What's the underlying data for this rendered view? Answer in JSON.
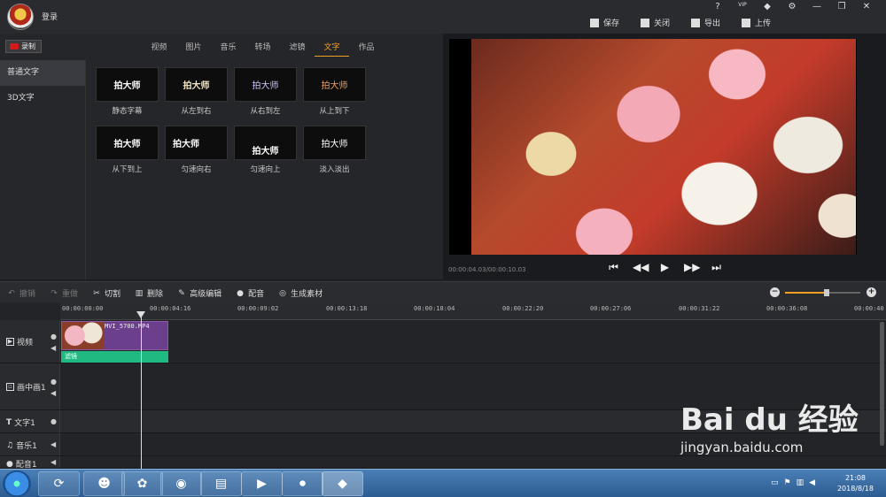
{
  "titlebar": {
    "login": "登录",
    "actions": [
      {
        "label": "保存",
        "icon": "save-icon"
      },
      {
        "label": "关闭",
        "icon": "close-doc-icon"
      },
      {
        "label": "导出",
        "icon": "export-icon"
      },
      {
        "label": "上传",
        "icon": "upload-icon"
      }
    ],
    "window_controls": [
      "?",
      "VIP",
      "◆",
      "⚙",
      "—",
      "❐",
      "✕"
    ]
  },
  "left_panel": {
    "record_label": "录制",
    "tabs": [
      "视频",
      "图片",
      "音乐",
      "转场",
      "滤镜",
      "文字",
      "作品"
    ],
    "active_tab": "文字",
    "categories": [
      "普通文字",
      "3D文字"
    ],
    "templates": [
      {
        "preview": "拍大师",
        "label": "静态字幕"
      },
      {
        "preview": "拍大师",
        "label": "从左到右"
      },
      {
        "preview": "拍大师",
        "label": "从右到左"
      },
      {
        "preview": "拍大师",
        "label": "从上到下"
      },
      {
        "preview": "拍大师",
        "label": "从下到上"
      },
      {
        "preview": "拍大师",
        "label": "匀速向右"
      },
      {
        "preview": "拍大师",
        "label": "匀速向上"
      },
      {
        "preview": "拍大师",
        "label": "淡入淡出"
      }
    ]
  },
  "preview": {
    "timecode": "00:00:04.03/00:00:10.03",
    "zoom_level": 0.55
  },
  "toolbar": {
    "tools": [
      {
        "label": "撤销",
        "icon": "undo-icon",
        "enabled": false
      },
      {
        "label": "重做",
        "icon": "redo-icon",
        "enabled": false
      },
      {
        "label": "切割",
        "icon": "scissors-icon",
        "enabled": true
      },
      {
        "label": "删除",
        "icon": "trash-icon",
        "enabled": true
      },
      {
        "label": "高级编辑",
        "icon": "edit-icon",
        "enabled": true
      },
      {
        "label": "配音",
        "icon": "microphone-icon",
        "enabled": true
      },
      {
        "label": "生成素材",
        "icon": "film-icon",
        "enabled": true
      }
    ]
  },
  "timeline": {
    "ticks": [
      "00:00:00:00",
      "00:00:04:16",
      "00:00:09:02",
      "00:00:13:18",
      "00:00:18:04",
      "00:00:22:20",
      "00:00:27:06",
      "00:00:31:22",
      "00:00:36:08",
      "00:00:40"
    ],
    "tracks": [
      {
        "name": "视频",
        "icon": "play-icon"
      },
      {
        "name": "画中画1",
        "icon": "pip-icon"
      },
      {
        "name": "文字1",
        "icon": "text-icon"
      },
      {
        "name": "音乐1",
        "icon": "music-icon"
      },
      {
        "name": "配音1",
        "icon": "microphone-icon"
      }
    ],
    "clip_name": "MVI_5700.MP4",
    "filter_label": "滤镜"
  },
  "taskbar": {
    "time": "21:08",
    "date": "2018/8/18"
  },
  "watermark": {
    "logo": "Bai du 经验",
    "url": "jingyan.baidu.com"
  }
}
